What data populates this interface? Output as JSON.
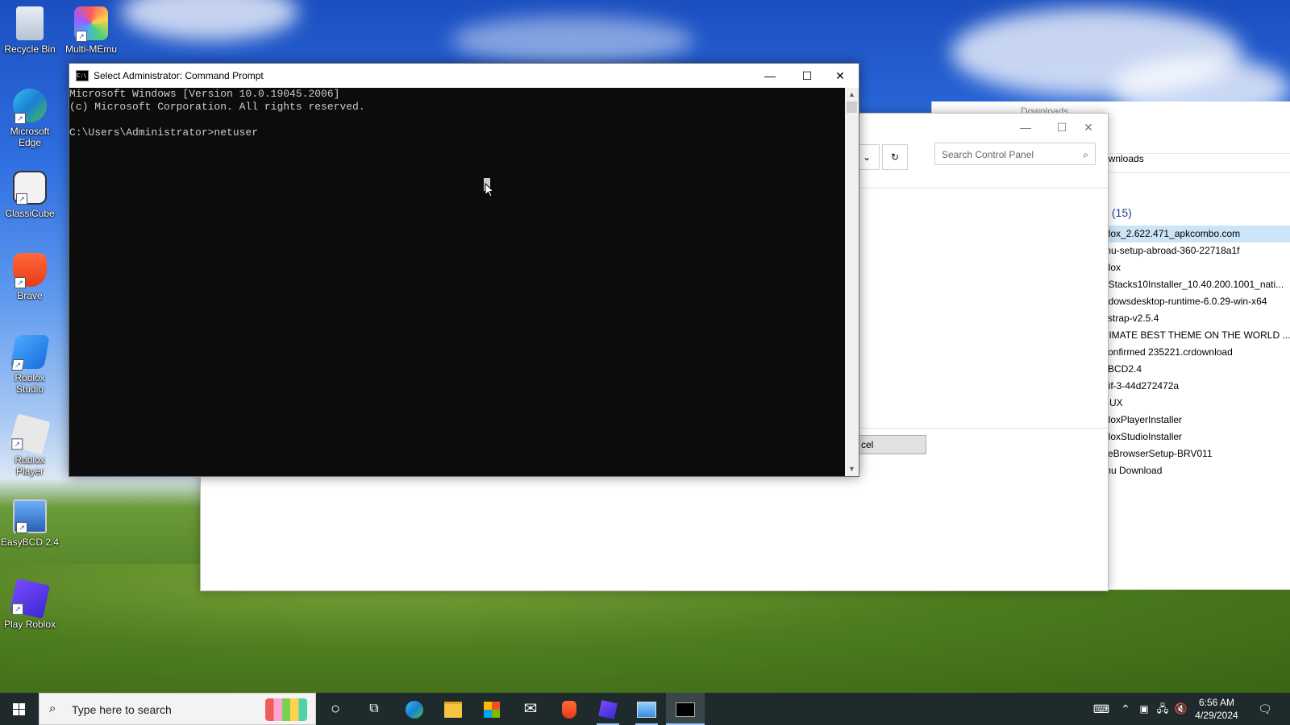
{
  "desktop": {
    "icons": [
      {
        "label": "Recycle Bin",
        "icon": "recycle-bin-icon"
      },
      {
        "label": "Multi-MEmu",
        "icon": "multi-memu-icon"
      },
      {
        "label": "Microsoft Edge",
        "icon": "edge-icon"
      },
      {
        "label": "ClassiCube",
        "icon": "classicube-icon"
      },
      {
        "label": "Brave",
        "icon": "brave-icon"
      },
      {
        "label": "Roblox Studio",
        "icon": "roblox-studio-icon"
      },
      {
        "label": "Roblox Player",
        "icon": "roblox-player-icon"
      },
      {
        "label": "EasyBCD 2.4",
        "icon": "easybcd-icon"
      },
      {
        "label": "Play Roblox",
        "icon": "play-roblox-icon"
      }
    ]
  },
  "cmd_window": {
    "title": "Select Administrator: Command Prompt",
    "lines": [
      "Microsoft Windows [Version 10.0.19045.2006]",
      "(c) Microsoft Corporation. All rights reserved.",
      "",
      "C:\\Users\\Administrator>netuser"
    ],
    "minimize": "—",
    "maximize": "☐",
    "close": "✕"
  },
  "control_panel": {
    "search_placeholder": "Search Control Panel",
    "cancel_label": "cel",
    "refresh_icon": "↻",
    "dropdown_icon": "⌄"
  },
  "explorer": {
    "title_partial": "Downloads",
    "path_partial": "ownloads",
    "group_header": "y (15)",
    "files": [
      "blox_2.622.471_apkcombo.com",
      "mu-setup-abroad-360-22718a1f",
      "blox",
      "eStacks10Installer_10.40.200.1001_nati...",
      "ndowsdesktop-runtime-6.0.29-win-x64",
      "xstrap-v2.5.4",
      "TIMATE BEST THEME ON THE WORLD ...",
      "confirmed 235221.crdownload",
      "yBCD2.4",
      "gif-3-44d272472a",
      "BUX",
      "bloxPlayerInstaller",
      "bloxStudioInstaller",
      "veBrowserSetup-BRV011",
      "mu Download"
    ]
  },
  "taskbar": {
    "search_placeholder": "Type here to search",
    "time": "6:56 AM",
    "date": "4/29/2024"
  },
  "colors": {
    "console_bg": "#0c0c0c",
    "console_fg": "#cccccc",
    "taskbar_bg": "#1f2a2d",
    "selection": "#cce4f7"
  }
}
